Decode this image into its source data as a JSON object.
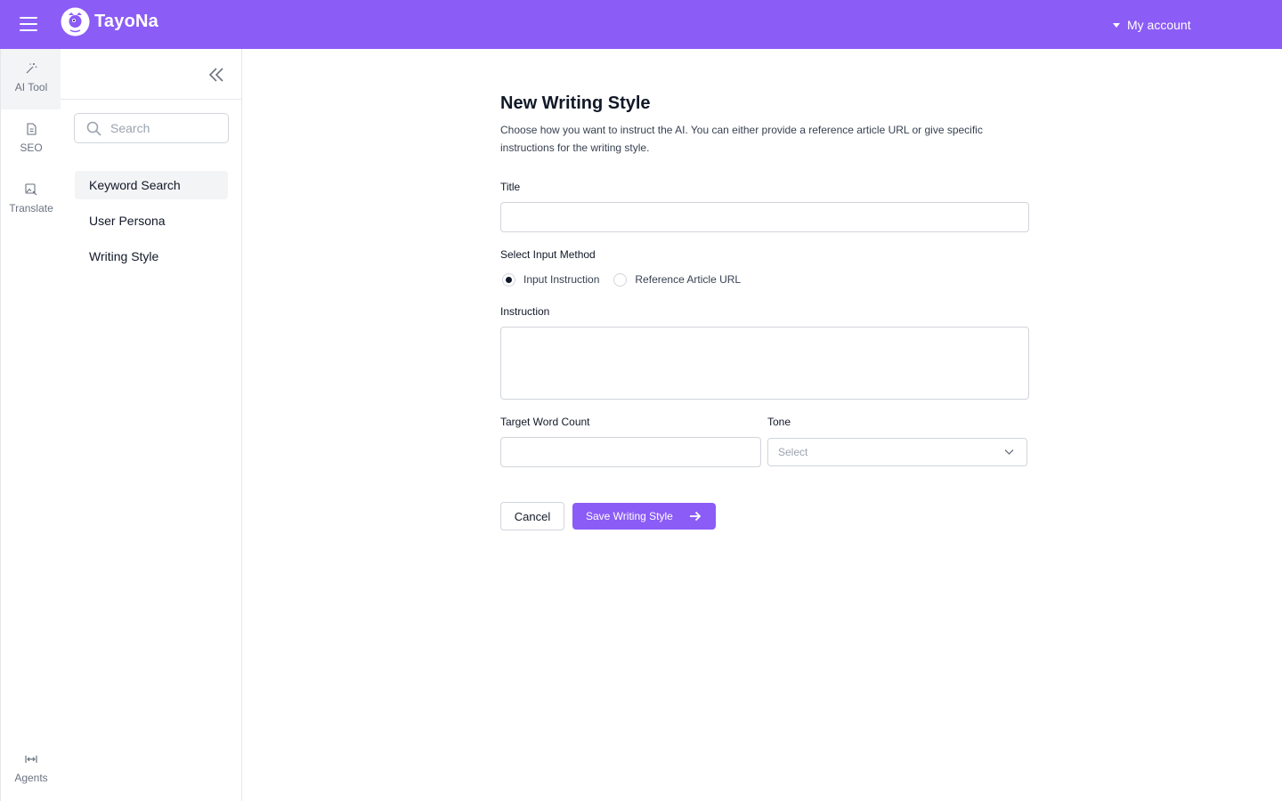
{
  "header": {
    "brand": "TayoNa",
    "account_label": "My account"
  },
  "rail": {
    "items": [
      {
        "label": "AI Tool",
        "icon": "magic-wand-icon",
        "active": true
      },
      {
        "label": "SEO",
        "icon": "document-icon"
      },
      {
        "label": "Translate",
        "icon": "image-edit-icon"
      }
    ],
    "bottom": {
      "label": "Agents",
      "icon": "expand-horizontal-icon"
    }
  },
  "sidebar": {
    "search_placeholder": "Search",
    "items": [
      {
        "label": "Keyword Search",
        "active": true
      },
      {
        "label": "User Persona"
      },
      {
        "label": "Writing Style"
      }
    ]
  },
  "form": {
    "title": "New Writing Style",
    "description": "Choose how you want to instruct the AI. You can either provide a reference article URL or give specific instructions for the writing style.",
    "title_label": "Title",
    "title_value": "",
    "method_label": "Select Input Method",
    "methods": [
      {
        "label": "Input Instruction",
        "selected": true
      },
      {
        "label": "Reference Article URL",
        "selected": false
      }
    ],
    "instruction_label": "Instruction",
    "instruction_value": "",
    "word_count_label": "Target Word Count",
    "word_count_value": "",
    "tone_label": "Tone",
    "tone_placeholder": "Select",
    "cancel_label": "Cancel",
    "save_label": "Save Writing Style"
  },
  "colors": {
    "brand": "#8b5cf6",
    "border": "#d1d5db",
    "active_bg": "#f3f4f6"
  }
}
